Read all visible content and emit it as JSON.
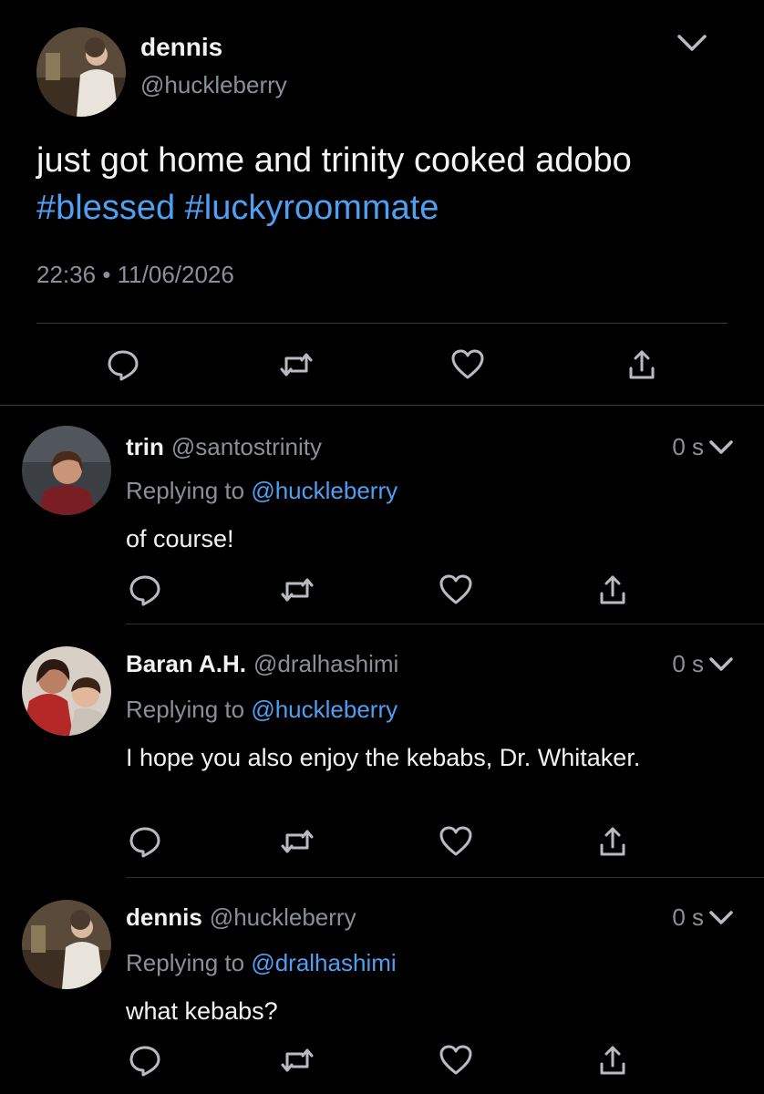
{
  "main_tweet": {
    "name": "dennis",
    "handle": "@huckleberry",
    "text_plain": "just got home and trinity cooked adobo",
    "hashtags": "#blessed #luckyroommate",
    "time": "22:36",
    "date": "11/06/2026",
    "meta_sep": "•"
  },
  "replies": [
    {
      "name": "trin",
      "handle": "@santostrinity",
      "time": "0 s",
      "replying_prefix": "Replying to",
      "replying_to": "@huckleberry",
      "text": "of course!"
    },
    {
      "name": "Baran A.H.",
      "handle": "@dralhashimi",
      "time": "0 s",
      "replying_prefix": "Replying to",
      "replying_to": "@huckleberry",
      "text": "I hope you also enjoy the kebabs, Dr. Whitaker."
    },
    {
      "name": "dennis",
      "handle": "@huckleberry",
      "time": "0 s",
      "replying_prefix": "Replying to",
      "replying_to": "@dralhashimi",
      "text": "what kebabs?"
    }
  ],
  "icons": {
    "reply": "speech-bubble-icon",
    "retweet": "retweet-icon",
    "like": "heart-icon",
    "share": "share-icon",
    "menu": "chevron-down-icon"
  },
  "colors": {
    "background": "#000000",
    "link": "#4f9ff2",
    "secondary_text": "#8b9096",
    "icon": "#b8bcc1"
  }
}
